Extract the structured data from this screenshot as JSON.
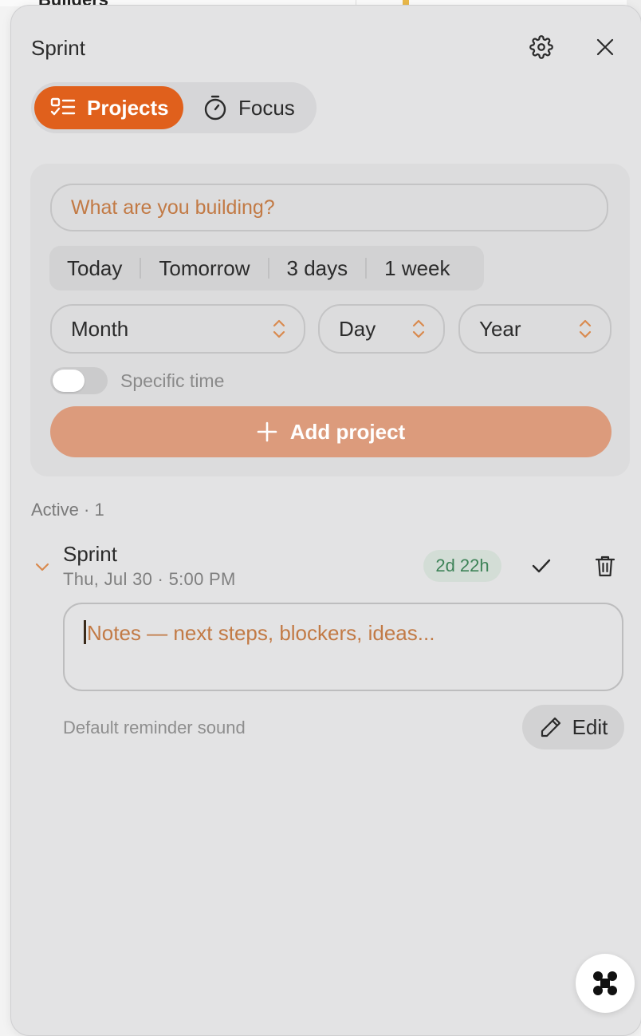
{
  "background_app": {
    "partial_title": "Builders"
  },
  "header": {
    "title": "Sprint"
  },
  "tabs": [
    {
      "label": "Projects",
      "icon": "checklist-icon",
      "active": true
    },
    {
      "label": "Focus",
      "icon": "stopwatch-icon",
      "active": false
    }
  ],
  "form": {
    "placeholder": "What are you building?",
    "quick_dates": [
      "Today",
      "Tomorrow",
      "3 days",
      "1 week"
    ],
    "selects": {
      "month": "Month",
      "day": "Day",
      "year": "Year"
    },
    "specific_time_label": "Specific time",
    "specific_time_on": false,
    "add_button": "Add project"
  },
  "active_section": {
    "label": "Active · 1"
  },
  "project": {
    "title": "Sprint",
    "due": "Thu, Jul 30 · 5:00 PM",
    "remaining": "2d 22h",
    "notes_placeholder": "Notes — next steps, blockers, ideas...",
    "reminder": "Default reminder sound",
    "edit_label": "Edit"
  },
  "colors": {
    "accent": "#e0601c",
    "add_button": "#dc9b7c",
    "badge_text": "#3e8358",
    "placeholder": "#c27a45"
  }
}
